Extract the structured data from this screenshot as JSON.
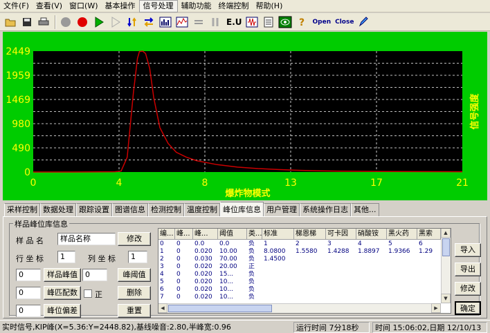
{
  "menu": [
    "文件(F)",
    "查看(V)",
    "窗口(W)",
    "基本操作",
    "信号处理",
    "辅助功能",
    "终端控制",
    "帮助(H)"
  ],
  "toolbar": {
    "text_buttons": {
      "eu": "E.U",
      "open": "Open",
      "close": "Close"
    },
    "icons": [
      "open-folder-icon",
      "save-icon",
      "print-icon",
      "gray-circle-icon",
      "record-red-icon",
      "play-green-icon",
      "play-outline-icon",
      "sort-down-icon",
      "swap-arrows-icon",
      "bar-chart-icon",
      "spectrum-icon",
      "equals-icon",
      "pause-icon",
      "eu-text",
      "pulse-icon",
      "document-icon",
      "screen-icon",
      "help-icon",
      "open-text",
      "close-text",
      "pen-icon"
    ]
  },
  "chart_data": {
    "type": "line",
    "xlabel": "爆炸物模式",
    "ylabel": "信号强度",
    "xlim": [
      0,
      21
    ],
    "ylim": [
      0,
      2449
    ],
    "x_ticks": [
      "0",
      "4",
      "8",
      "13",
      "17",
      "21"
    ],
    "y_ticks": [
      "2449",
      "1959",
      "1469",
      "980",
      "490",
      "0"
    ],
    "grid": true,
    "background": "#00cc00",
    "plot_bg": "#000000",
    "line_color": "#cc0000",
    "tick_color": "#ffff00",
    "x": [
      0,
      2,
      4,
      4.3,
      4.6,
      4.9,
      5.1,
      5.2,
      5.36,
      5.5,
      5.7,
      5.9,
      6.2,
      6.6,
      7,
      7.5,
      8,
      9,
      10,
      11,
      12,
      13,
      14,
      15,
      17,
      21
    ],
    "y": [
      0,
      0,
      5,
      20,
      300,
      1600,
      2300,
      2440,
      2449,
      2400,
      2100,
      1500,
      900,
      580,
      400,
      300,
      230,
      150,
      100,
      70,
      50,
      35,
      25,
      18,
      10,
      5
    ]
  },
  "tabs": [
    "采样控制",
    "数据处理",
    "跟踪设置",
    "图谱信息",
    "检测控制",
    "温度控制",
    "峰位库信息",
    "用户管理",
    "系统操作日志",
    "其他..."
  ],
  "active_tab": 6,
  "group": {
    "title": "样品峰位库信息",
    "sample_name_label": "样 品 名",
    "sample_name_value": "样品名称",
    "modify_btn": "修改",
    "row_coord_label": "行 坐 标",
    "row_coord_value": "1",
    "col_coord_label": "列 坐 标",
    "col_coord_value": "1",
    "peak_value_field": "0",
    "sample_peak_btn": "样品峰值",
    "threshold_field": "0",
    "peak_threshold_btn": "峰阈值",
    "match_field": "0",
    "peak_match_btn": "峰匹配数",
    "positive_label": "正",
    "delete_btn": "删除",
    "offset_field": "0",
    "peak_offset_btn": "峰位偏差",
    "reset_btn": "重置"
  },
  "table": {
    "headers": [
      "编...",
      "峰...",
      "峰...",
      "阈值",
      "类...",
      "标准",
      "梯恩梯",
      "可卡因",
      "硝酸铵",
      "黑火药",
      "黑索"
    ],
    "rows": [
      [
        "0",
        "0",
        "0.0",
        "0.0",
        "负",
        "1",
        "2",
        "3",
        "4",
        "5",
        "6"
      ],
      [
        "1",
        "0",
        "0.020",
        "10.00",
        "负",
        "8.0800",
        "1.5580",
        "1.4288",
        "1.8897",
        "1.9366",
        "1.29"
      ],
      [
        "2",
        "0",
        "0.030",
        "70.00",
        "负",
        "1.4500",
        "",
        "",
        "",
        "",
        ""
      ],
      [
        "3",
        "0",
        "0.020",
        "20.00",
        "正",
        "",
        "",
        "",
        "",
        "",
        ""
      ],
      [
        "4",
        "0",
        "0.020",
        "15...",
        "负",
        "",
        "",
        "",
        "",
        "",
        ""
      ],
      [
        "5",
        "0",
        "0.020",
        "10...",
        "负",
        "",
        "",
        "",
        "",
        "",
        ""
      ],
      [
        "6",
        "0",
        "0.020",
        "10...",
        "负",
        "",
        "",
        "",
        "",
        "",
        ""
      ],
      [
        "7",
        "0",
        "0.020",
        "10...",
        "负",
        "",
        "",
        "",
        "",
        "",
        ""
      ]
    ]
  },
  "side_buttons": [
    "导入",
    "导出",
    "修改",
    "确定"
  ],
  "status": {
    "signal": "实时信号,KIP峰(X=5.36:Y=2448.82),基线噪音:2.80,半峰宽:0.96",
    "runtime": "运行时间  7分18秒",
    "time": "时间  15:06:02,日期  12/10/13"
  }
}
